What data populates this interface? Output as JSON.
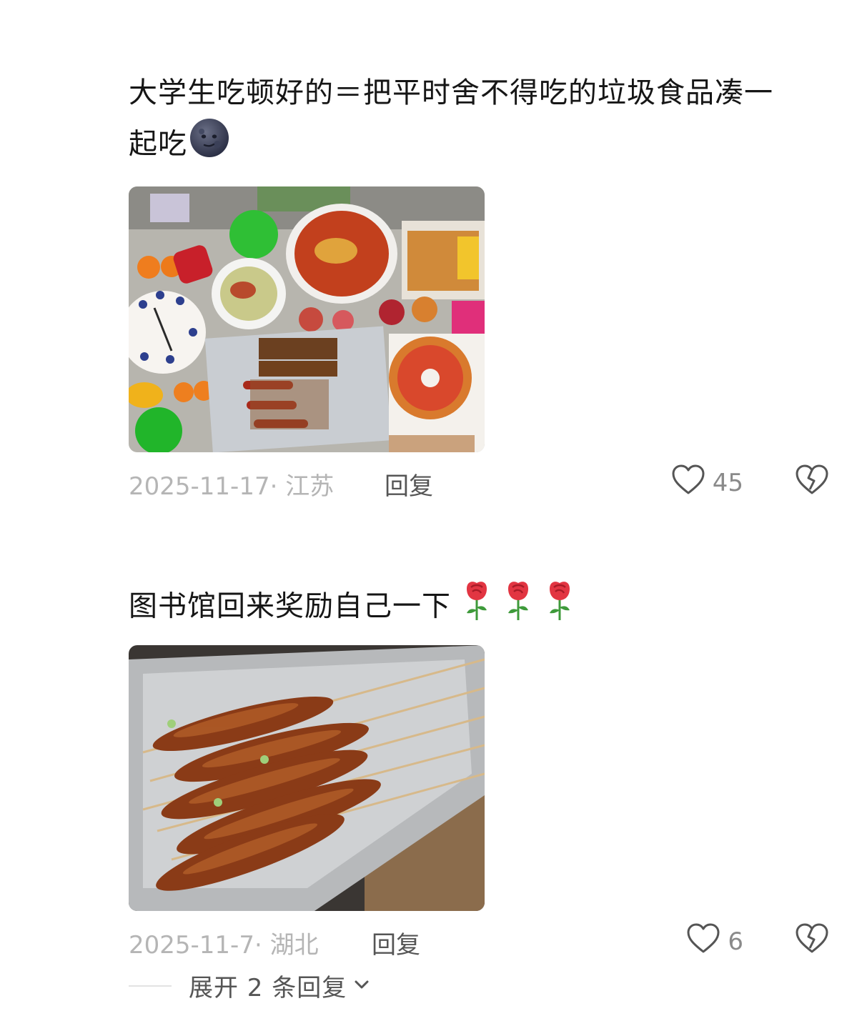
{
  "comments": [
    {
      "text_line1": "大学生吃顿好的＝把平时舍不得吃的垃圾食品凑一",
      "text_line2": "起吃",
      "emoji": "new-moon-face",
      "photo": "food-spread-photo",
      "date": "2025-11-17",
      "location": "江苏",
      "meta": "2025-11-17· 江苏",
      "reply_label": "回复",
      "likes": "45"
    },
    {
      "text": "图书馆回来奖励自己一下",
      "emoji": "rose",
      "emoji_count": 3,
      "photo": "skewers-photo",
      "date": "2025-11-7",
      "location": "湖北",
      "meta": "2025-11-7· 湖北",
      "reply_label": "回复",
      "likes": "6"
    }
  ],
  "expand": {
    "label": "展开 2 条回复",
    "icon": "chevron-down-icon"
  },
  "colors": {
    "text": "#161616",
    "meta": "#b5b5b5",
    "reply": "#555555",
    "icon": "#555555"
  }
}
